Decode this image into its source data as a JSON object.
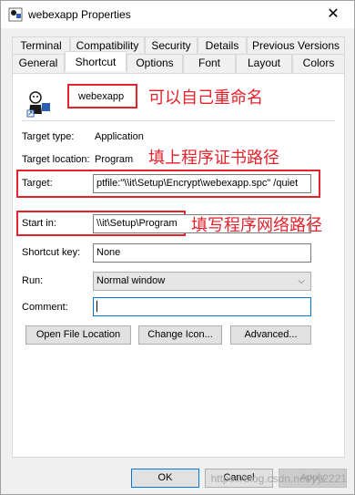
{
  "window": {
    "title": "webexapp Properties",
    "close_glyph": "✕"
  },
  "tabs_top": [
    "Terminal",
    "Compatibility",
    "Security",
    "Details",
    "Previous Versions"
  ],
  "tabs_bottom": [
    "General",
    "Shortcut",
    "Options",
    "Font",
    "Layout",
    "Colors"
  ],
  "shortcut": {
    "name": "webexapp",
    "target_type_label": "Target type:",
    "target_type_value": "Application",
    "target_location_label": "Target location:",
    "target_location_value": "Program",
    "target_label": "Target:",
    "target_value": "ptfile:\"\\\\it\\Setup\\Encrypt\\webexapp.spc\" /quiet",
    "start_in_label": "Start in:",
    "start_in_value": "\\\\it\\Setup\\Program",
    "shortcut_key_label": "Shortcut key:",
    "shortcut_key_value": "None",
    "run_label": "Run:",
    "run_value": "Normal window",
    "comment_label": "Comment:",
    "comment_value": "",
    "open_location_btn": "Open File Location",
    "change_icon_btn": "Change Icon...",
    "advanced_btn": "Advanced..."
  },
  "footer": {
    "ok": "OK",
    "cancel": "Cancel",
    "apply": "Apply"
  },
  "annotations": {
    "rename": "可以自己重命名",
    "target": "填上程序证书路径",
    "start_in": "填写程序网络路径"
  },
  "watermark": "https://blog.csdn.net/yy2221",
  "colors": {
    "annotation": "#e4222b",
    "focus": "#0078d7"
  },
  "icons": {
    "app": "webex-person-icon",
    "arrow": "chevron-down-icon"
  }
}
